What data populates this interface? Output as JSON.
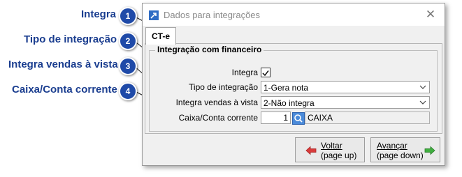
{
  "callouts": [
    {
      "number": "1",
      "label": "Integra"
    },
    {
      "number": "2",
      "label": "Tipo de integração"
    },
    {
      "number": "3",
      "label": "Integra vendas à vista"
    },
    {
      "number": "4",
      "label": "Caixa/Conta corrente"
    }
  ],
  "window": {
    "title": "Dados para integrações",
    "tab_label": "CT-e",
    "group_title": "Integração com financeiro",
    "fields": {
      "integra_label": "Integra",
      "integra_checked": true,
      "tipo_label": "Tipo de integração",
      "tipo_value": "1-Gera nota",
      "vendas_label": "Integra vendas à vista",
      "vendas_value": "2-Não integra",
      "caixa_label": "Caixa/Conta corrente",
      "caixa_code": "1",
      "caixa_name": "CAIXA"
    },
    "buttons": {
      "voltar_line1": "Voltar",
      "voltar_line2": "(page up)",
      "avancar_line1": "Avançar",
      "avancar_line2": "(page down)"
    }
  },
  "colors": {
    "callout_text": "#1a3d8f",
    "badge": "#1f4aa8",
    "back_arrow": "#d83b3b",
    "next_arrow": "#3fae3f"
  }
}
